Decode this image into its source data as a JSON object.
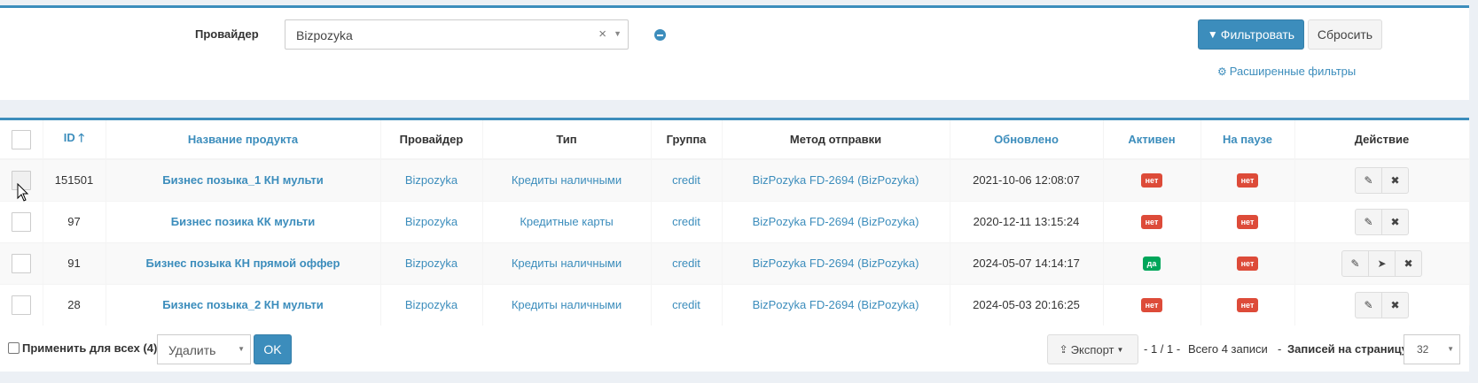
{
  "filters": {
    "provider_label": "Провайдер",
    "provider_value": "Bizpozyka",
    "clear_glyph": "×",
    "filter_button": "Фильтровать",
    "reset_button": "Сбросить",
    "advanced_filters": "Расширенные фильтры"
  },
  "table": {
    "headers": {
      "id": "ID",
      "name": "Название продукта",
      "provider": "Провайдер",
      "type": "Тип",
      "group": "Группа",
      "method": "Метод отправки",
      "updated": "Обновлено",
      "active": "Активен",
      "paused": "На паузе",
      "action": "Действие"
    },
    "rows": [
      {
        "id": "151501",
        "name": "Бизнес позыка_1 КН мульти",
        "provider": "Bizpozyka",
        "type": "Кредиты наличными",
        "group": "credit",
        "method": "BizPozyka FD-2694 (BizPozyka)",
        "updated": "2021-10-06 12:08:07",
        "active": "нет",
        "paused": "нет"
      },
      {
        "id": "97",
        "name": "Бизнес позика КК мульти",
        "provider": "Bizpozyka",
        "type": "Кредитные карты",
        "group": "credit",
        "method": "BizPozyka FD-2694 (BizPozyka)",
        "updated": "2020-12-11 13:15:24",
        "active": "нет",
        "paused": "нет"
      },
      {
        "id": "91",
        "name": "Бизнес позыка КН прямой оффер",
        "provider": "Bizpozyka",
        "type": "Кредиты наличными",
        "group": "credit",
        "method": "BizPozyka FD-2694 (BizPozyka)",
        "updated": "2024-05-07 14:14:17",
        "active": "да",
        "paused": "нет"
      },
      {
        "id": "28",
        "name": "Бизнес позыка_2 КН мульти",
        "provider": "Bizpozyka",
        "type": "Кредиты наличными",
        "group": "credit",
        "method": "BizPozyka FD-2694 (BizPozyka)",
        "updated": "2024-05-03 20:16:25",
        "active": "нет",
        "paused": "нет"
      }
    ]
  },
  "footer": {
    "apply_all": "Применить для всех (4)",
    "bulk_action": "Удалить",
    "ok_button": "OK",
    "export_button": "Экспорт",
    "page_info": "- 1 / 1 -",
    "total": "Всего 4 записи",
    "dash": "-",
    "per_page_label": "Записей на страницу",
    "per_page_value": "32"
  },
  "colors": {
    "primary": "#3c8dbc",
    "danger": "#dd4b39",
    "success": "#00a65a"
  },
  "icons": [
    "filter-icon",
    "cogs-icon",
    "sort-asc-icon",
    "pencil-icon",
    "times-icon",
    "send-icon",
    "share-icon",
    "caret-down-icon"
  ]
}
